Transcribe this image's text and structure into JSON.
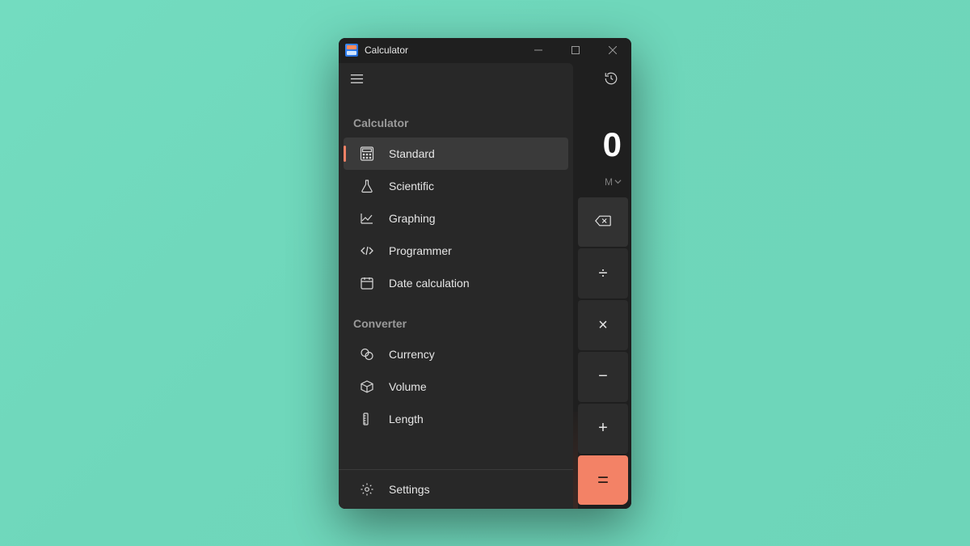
{
  "window": {
    "title": "Calculator"
  },
  "titlebar": {
    "minimize_label": "Minimize",
    "maximize_label": "Maximize",
    "close_label": "Close"
  },
  "top": {
    "history_label": "History"
  },
  "display": {
    "value": "0",
    "memory_label": "M"
  },
  "keys": {
    "backspace": "⌫",
    "divide": "÷",
    "multiply": "×",
    "minus": "−",
    "plus": "+",
    "equals": "="
  },
  "nav": {
    "hamburger_label": "Open navigation",
    "groups": {
      "calculator": {
        "title": "Calculator",
        "items": [
          {
            "label": "Standard",
            "selected": true
          },
          {
            "label": "Scientific"
          },
          {
            "label": "Graphing"
          },
          {
            "label": "Programmer"
          },
          {
            "label": "Date calculation"
          }
        ]
      },
      "converter": {
        "title": "Converter",
        "items": [
          {
            "label": "Currency"
          },
          {
            "label": "Volume"
          },
          {
            "label": "Length"
          }
        ]
      }
    },
    "settings_label": "Settings"
  },
  "colors": {
    "accent": "#f38266",
    "key_bg": "#2c2c2c",
    "window_bg": "#1f1f1f"
  }
}
